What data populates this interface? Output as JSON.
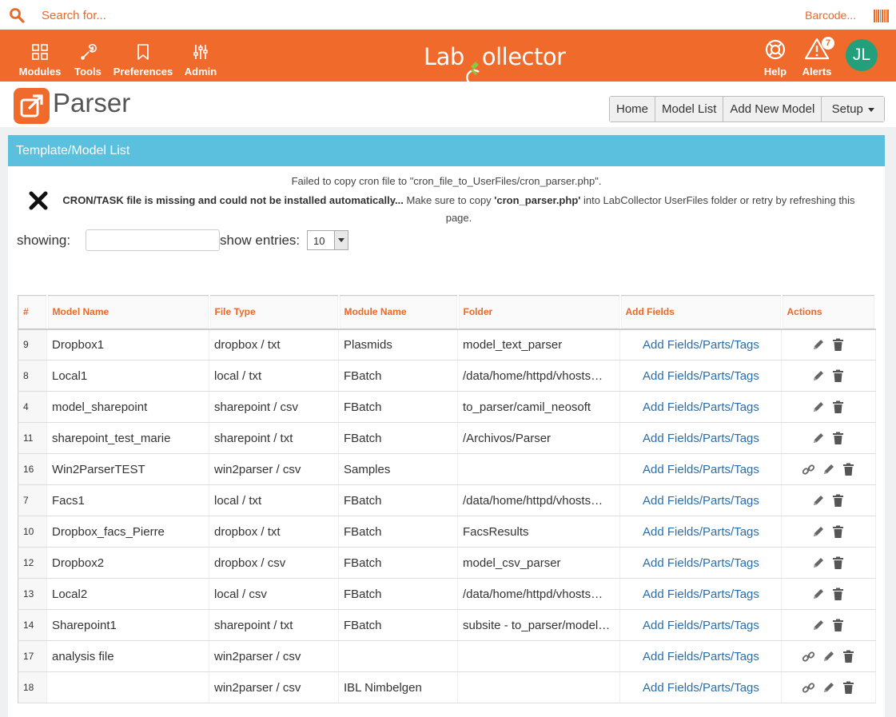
{
  "search": {
    "placeholder": "Search for...",
    "barcode_label": "Barcode..."
  },
  "nav": {
    "items": [
      {
        "label": "Modules",
        "icon": "grid-icon"
      },
      {
        "label": "Tools",
        "icon": "wrench-icon"
      },
      {
        "label": "Preferences",
        "icon": "bookmark-icon"
      },
      {
        "label": "Admin",
        "icon": "sliders-icon"
      }
    ],
    "logo": {
      "left": "Lab",
      "right": "ollector"
    },
    "help_label": "Help",
    "alerts_label": "Alerts",
    "alerts_count": "7",
    "avatar_initials": "JL"
  },
  "page": {
    "title": "Parser",
    "buttons": {
      "home": "Home",
      "model_list": "Model List",
      "add_new_model": "Add New Model",
      "setup": "Setup"
    }
  },
  "panel": {
    "title": "Template/Model List",
    "msg_copy_failed": "Failed to copy cron file to \"cron_file_to_UserFiles/cron_parser.php\".",
    "msg_missing_bold": "CRON/TASK file is missing and could not be installed automatically...",
    "msg_missing_text_a": " Make sure to copy ",
    "msg_missing_file": "'cron_parser.php'",
    "msg_missing_text_b": " into LabCollector UserFiles folder or retry by refreshing this page."
  },
  "filters": {
    "showing_label": "showing:",
    "entries_label": "show entries:",
    "entries_value": "10"
  },
  "table": {
    "headers": [
      "#",
      "Model Name",
      "File Type",
      "Module Name",
      "Folder",
      "Add Fields",
      "Actions"
    ],
    "add_fields_label": "Add Fields/Parts/Tags",
    "rows": [
      {
        "id": "9",
        "name": "Dropbox1",
        "file_type": "dropbox / txt",
        "module": "Plasmids",
        "folder": "model_text_parser",
        "link": false
      },
      {
        "id": "8",
        "name": "Local1",
        "file_type": "local / txt",
        "module": "FBatch",
        "folder": "/data/home/httpd/vhosts…",
        "link": false
      },
      {
        "id": "4",
        "name": "model_sharepoint",
        "file_type": "sharepoint / csv",
        "module": "FBatch",
        "folder": "to_parser/camil_neosoft",
        "link": false
      },
      {
        "id": "11",
        "name": "sharepoint_test_marie",
        "file_type": "sharepoint / txt",
        "module": "FBatch",
        "folder": "/Archivos/Parser",
        "link": false
      },
      {
        "id": "16",
        "name": "Win2ParserTEST",
        "file_type": "win2parser / csv",
        "module": "Samples",
        "folder": "",
        "link": true
      },
      {
        "id": "7",
        "name": "Facs1",
        "file_type": "local / txt",
        "module": "FBatch",
        "folder": "/data/home/httpd/vhosts…",
        "link": false
      },
      {
        "id": "10",
        "name": "Dropbox_facs_Pierre",
        "file_type": "dropbox / txt",
        "module": "FBatch",
        "folder": "FacsResults",
        "link": false
      },
      {
        "id": "12",
        "name": "Dropbox2",
        "file_type": "dropbox / csv",
        "module": "FBatch",
        "folder": "model_csv_parser",
        "link": false
      },
      {
        "id": "13",
        "name": "Local2",
        "file_type": "local / csv",
        "module": "FBatch",
        "folder": "/data/home/httpd/vhosts…",
        "link": false
      },
      {
        "id": "14",
        "name": "Sharepoint1",
        "file_type": "sharepoint / txt",
        "module": "FBatch",
        "folder": "subsite - to_parser/model…",
        "link": false
      },
      {
        "id": "17",
        "name": "analysis file",
        "file_type": "win2parser / csv",
        "module": "",
        "folder": "",
        "link": true
      },
      {
        "id": "18",
        "name": "",
        "file_type": "win2parser / csv",
        "module": "IBL Nimbelgen",
        "folder": "",
        "link": true
      }
    ]
  },
  "colors": {
    "brand_orange": "#ef6a2b",
    "panel_header": "#5bc0de",
    "link_blue": "#2a6ea9",
    "avatar_green": "#22a07b"
  }
}
